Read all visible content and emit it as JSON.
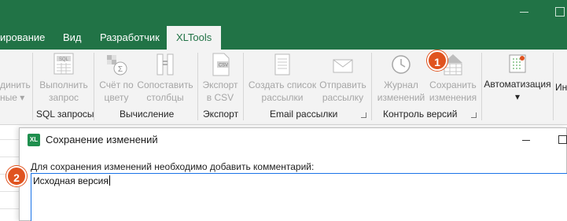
{
  "tabs": [
    {
      "label": "ирование"
    },
    {
      "label": "Вид"
    },
    {
      "label": "Разработчик"
    },
    {
      "label": "XLTools",
      "active": true
    }
  ],
  "ribbon": {
    "buttons": [
      {
        "label1": "динить",
        "label2": "ные ▾",
        "enabled": false
      },
      {
        "label1": "Выполнить",
        "label2": "запрос",
        "enabled": false
      },
      {
        "label1": "Счёт по",
        "label2": "цвету",
        "enabled": false
      },
      {
        "label1": "Сопоставить",
        "label2": "столбцы",
        "enabled": false
      },
      {
        "label1": "Экспорт",
        "label2": "в CSV",
        "enabled": false
      },
      {
        "label1": "Создать список",
        "label2": "рассылки",
        "enabled": false
      },
      {
        "label1": "Отправить",
        "label2": "рассылку",
        "enabled": false
      },
      {
        "label1": "Журнал",
        "label2": "изменений",
        "enabled": false
      },
      {
        "label1": "Сохранить",
        "label2": "изменения",
        "enabled": false
      },
      {
        "label1": "Автоматизация",
        "label2": "▾",
        "enabled": true
      },
      {
        "label1": "Ин",
        "label2": "",
        "enabled": true
      }
    ],
    "groups": [
      "SQL запросы",
      "Вычисление",
      "Экспорт",
      "Email рассылки",
      "Контроль версий"
    ],
    "icon_texts": {
      "sql": "SQL",
      "csv": "CSV"
    }
  },
  "dialog": {
    "logo": "XL",
    "title": "Сохранение изменений",
    "prompt": "Для сохранения изменений необходимо добавить комментарий:",
    "comment_value": "Исходная версия"
  },
  "steps": [
    "1",
    "2"
  ],
  "colors": {
    "accent": "#217346",
    "step": "#e0531f",
    "input_border": "#1a73e8"
  }
}
